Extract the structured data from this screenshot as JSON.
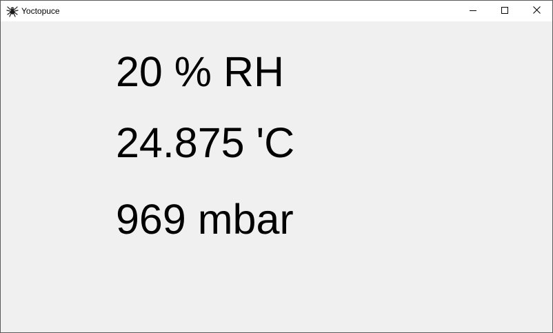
{
  "window": {
    "title": "Yoctopuce",
    "icon": "yoctopuce-spider-icon"
  },
  "controls": {
    "minimize": "minimize-icon",
    "maximize": "maximize-icon",
    "close": "close-icon"
  },
  "readings": {
    "humidity": "20 % RH",
    "temperature": "24.875 'C",
    "pressure": "969 mbar"
  },
  "colors": {
    "background": "#f0f0f0",
    "titlebar": "#ffffff",
    "text": "#000000"
  }
}
